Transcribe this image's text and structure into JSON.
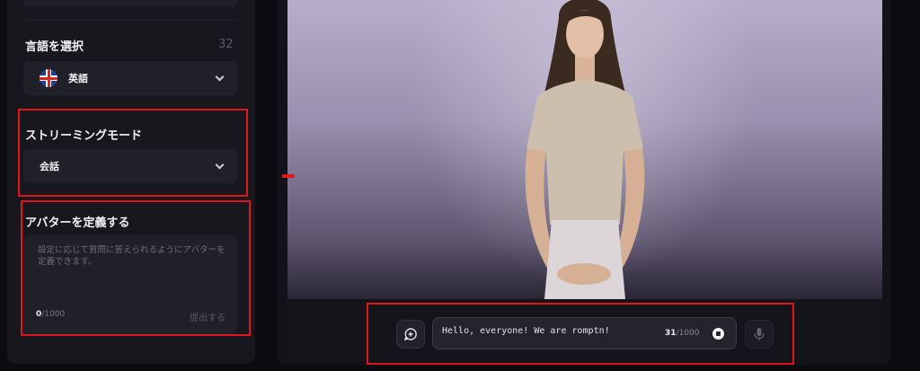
{
  "sidebar": {
    "language": {
      "title": "言語を選択",
      "count": "32",
      "selected": "英語",
      "flag_icon": "uk-flag-icon"
    },
    "streaming": {
      "title": "ストリーミングモード",
      "selected": "会話"
    },
    "avatar": {
      "title": "アバターを定義する",
      "placeholder": "設定に応じて質問に答えられるようにアバターを定義できます。",
      "count_current": "0",
      "count_max": "/1000",
      "submit_label": "提出する"
    }
  },
  "chat": {
    "input_value": "Hello, everyone! We are romptn!",
    "count_current": "31",
    "count_max": "/1000",
    "add_icon": "add-chat-icon",
    "mic_icon": "microphone-icon",
    "stop_icon": "stop-icon"
  },
  "colors": {
    "highlight": "#e0161b",
    "panel": "#17171d",
    "field": "#202028"
  }
}
